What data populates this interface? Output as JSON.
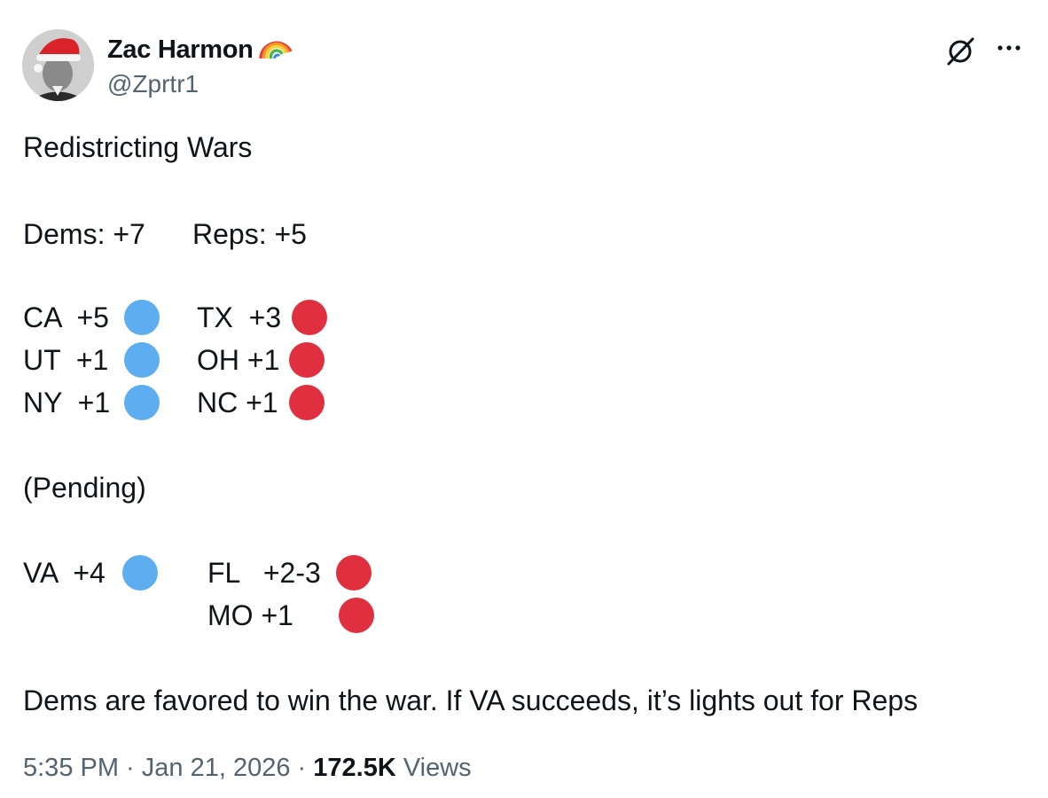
{
  "author": {
    "display_name": "Zac Harmon",
    "name_emoji": "rainbow",
    "handle": "@Zprtr1"
  },
  "actions": {
    "grok_icon": "grok-icon",
    "more_icon": "more-icon"
  },
  "post": {
    "title": "Redistricting Wars",
    "totals": {
      "dems": "Dems: +7",
      "reps": "Reps: +5"
    },
    "dem_rows": [
      "CA  +5",
      "UT  +1",
      "NY  +1"
    ],
    "rep_rows": [
      "TX  +3",
      "OH +1",
      "NC +1"
    ],
    "pending_label": "(Pending)",
    "pending_dem": [
      "VA  +4"
    ],
    "pending_rep": [
      "FL   +2-3",
      "MO +1"
    ],
    "conclusion": "Dems are favored to win the war. If VA succeeds, it’s lights out for Reps"
  },
  "meta": {
    "time": "5:35 PM",
    "separator": " · ",
    "date": "Jan 21, 2026",
    "views_count": "172.5K",
    "views_label": " Views"
  },
  "colors": {
    "dem_dot": "#5daef0",
    "rep_dot": "#e0303f",
    "secondary_text": "#536471"
  }
}
